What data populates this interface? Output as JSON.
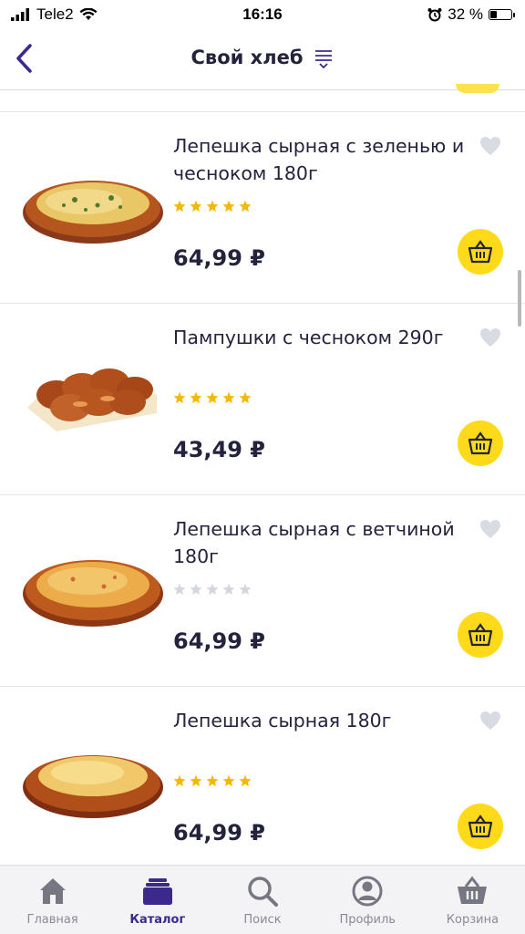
{
  "status_bar": {
    "carrier": "Tele2",
    "time": "16:16",
    "battery": "32 %"
  },
  "nav": {
    "title": "Свой хлеб"
  },
  "products": [
    {
      "title": "Лепешка сырная с зеленью и чесноком 180г",
      "price": "64,99 ₽",
      "rating": 5,
      "image": "flatbread-herbs"
    },
    {
      "title": "Пампушки с чесноком 290г",
      "price": "43,49 ₽",
      "rating": 5,
      "image": "garlic-buns"
    },
    {
      "title": "Лепешка сырная с ветчиной 180г",
      "price": "64,99 ₽",
      "rating": 0,
      "image": "flatbread-ham"
    },
    {
      "title": "Лепешка сырная 180г",
      "price": "64,99 ₽",
      "rating": 5,
      "image": "flatbread-cheese"
    }
  ],
  "tabs": [
    {
      "label": "Главная",
      "icon": "home-icon",
      "active": false
    },
    {
      "label": "Каталог",
      "icon": "catalog-icon",
      "active": true
    },
    {
      "label": "Поиск",
      "icon": "search-icon",
      "active": false
    },
    {
      "label": "Профиль",
      "icon": "profile-icon",
      "active": false
    },
    {
      "label": "Корзина",
      "icon": "cart-icon",
      "active": false
    }
  ],
  "colors": {
    "accent": "#3b2a8c",
    "cart_button": "#ffda1a",
    "star_filled": "#f5b800",
    "star_empty": "#d4d6df",
    "text": "#23233d"
  }
}
